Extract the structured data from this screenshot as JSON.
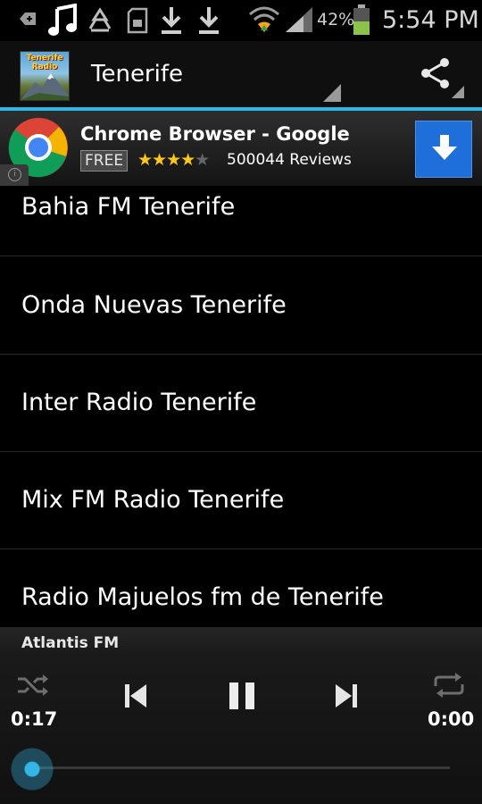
{
  "status_bar": {
    "battery_percent": "42%",
    "time": "5:54 PM",
    "icons": [
      "notification-icon",
      "music-icon",
      "recycle-icon",
      "sd-card-icon",
      "download-icon",
      "download-icon",
      "wifi-icon",
      "signal-icon",
      "battery-icon"
    ]
  },
  "action_bar": {
    "app_logo_text": "Tenerife Radio",
    "title": "Tenerife",
    "share_icon": "share-icon"
  },
  "ad": {
    "title": "Chrome Browser - Google",
    "price_badge": "FREE",
    "rating": 4,
    "rating_max": 5,
    "reviews": "500044 Reviews",
    "download_icon": "download-arrow-icon"
  },
  "stations": [
    {
      "label": "Bahia FM Tenerife"
    },
    {
      "label": "Onda Nuevas Tenerife"
    },
    {
      "label": "Inter Radio Tenerife"
    },
    {
      "label": "Mix FM Radio Tenerife"
    },
    {
      "label": "Radio Majuelos fm de Tenerife"
    }
  ],
  "player": {
    "now_playing": "Atlantis FM",
    "elapsed": "0:17",
    "remaining": "0:00",
    "progress": 0.0,
    "controls": [
      "shuffle-icon",
      "previous-icon",
      "pause-icon",
      "next-icon",
      "repeat-icon"
    ]
  },
  "colors": {
    "accent": "#33b5e5",
    "background": "#000000",
    "ad_button": "#1e6fd9",
    "star": "#ffc81a"
  }
}
